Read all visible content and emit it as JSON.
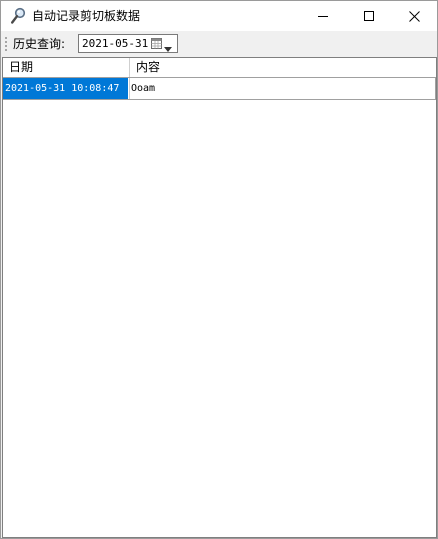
{
  "window": {
    "title": "自动记录剪切板数据",
    "icon": "magnifier-icon"
  },
  "toolbar": {
    "query_label": "历史查询:",
    "date_value": "2021-05-31"
  },
  "grid": {
    "columns": [
      "日期",
      "内容"
    ],
    "rows": [
      {
        "date": "2021-05-31 10:08:47",
        "content": "Ooam",
        "selected": true
      }
    ]
  },
  "colors": {
    "selection": "#0078d7",
    "window_bg": "#f0f0f0",
    "titlebar_bg": "#ffffff"
  }
}
